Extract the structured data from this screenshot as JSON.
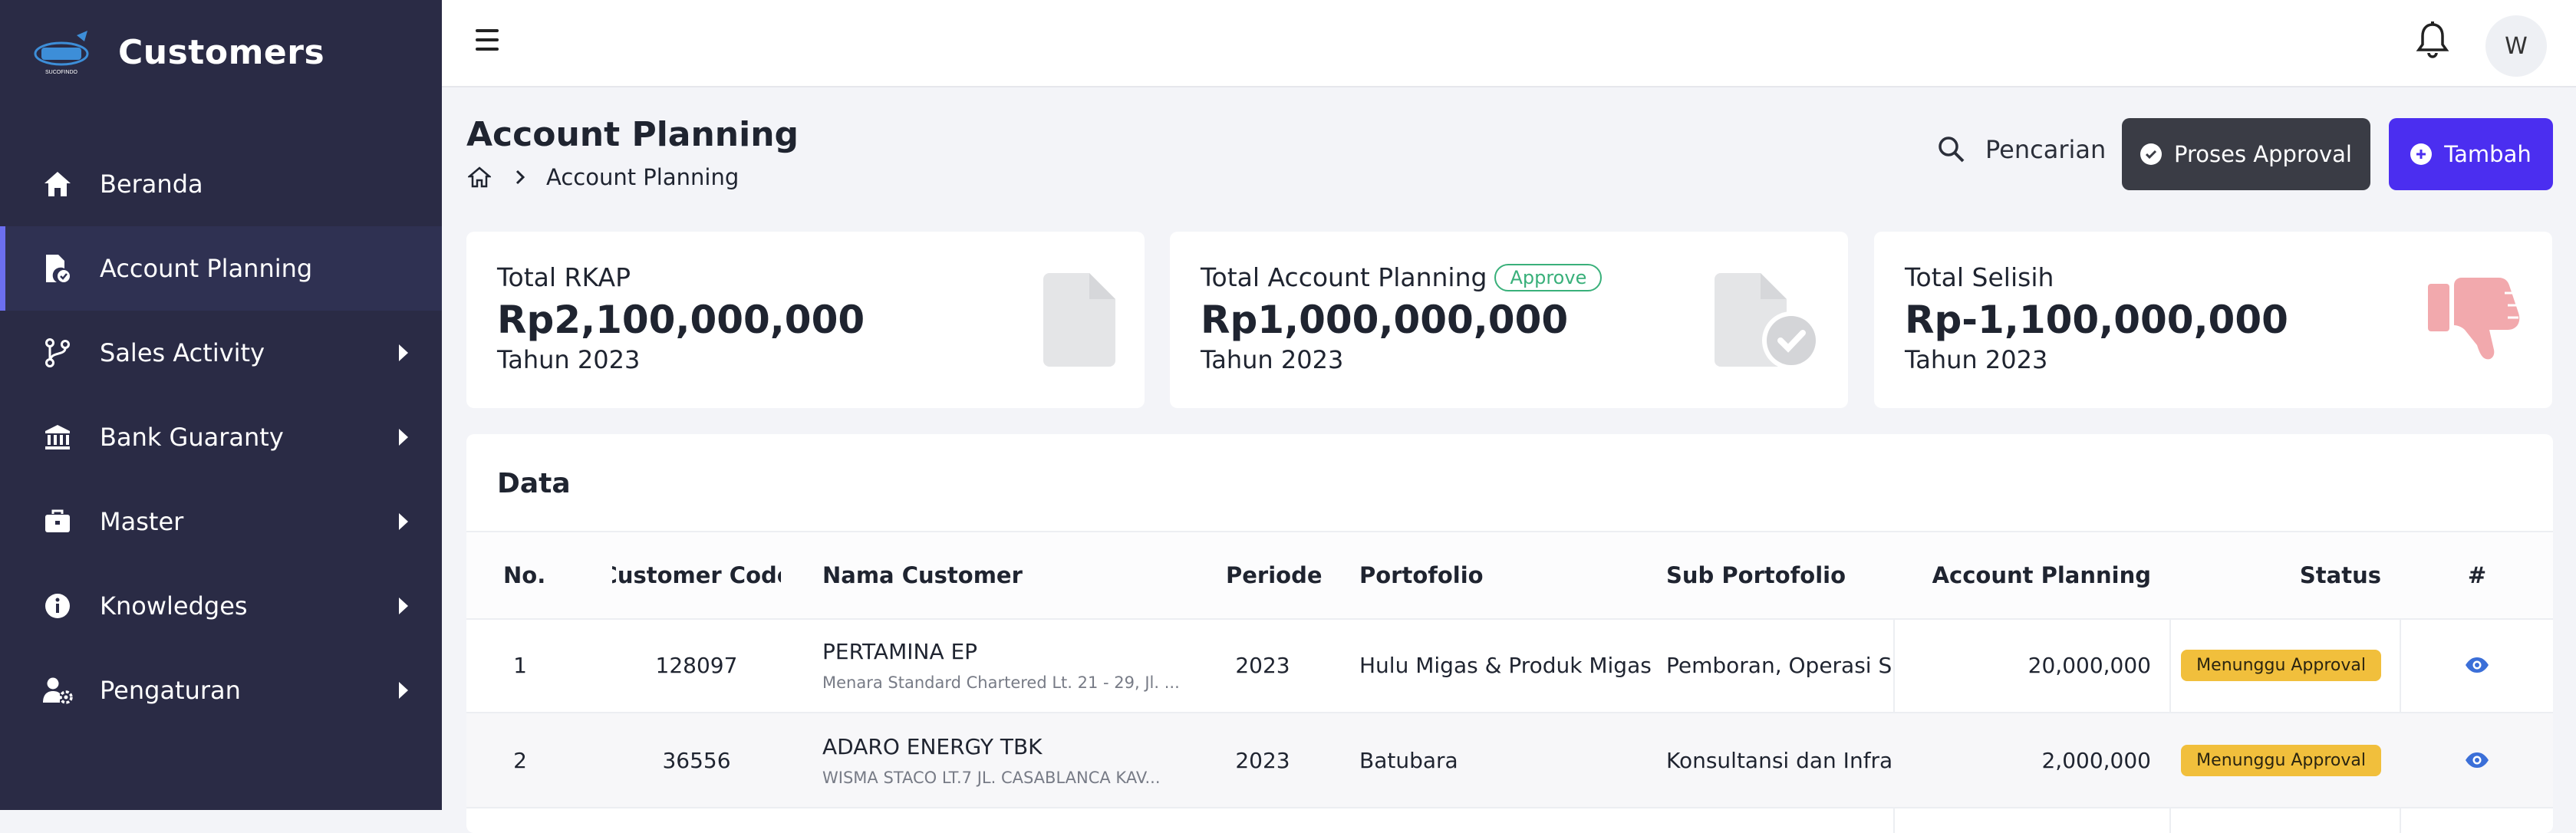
{
  "app": {
    "title": "Customers",
    "logo_text": "SUCOFINDO"
  },
  "sidebar": {
    "items": [
      {
        "label": "Beranda",
        "icon": "home-icon",
        "active": false,
        "expandable": false
      },
      {
        "label": "Account Planning",
        "icon": "file-check-icon",
        "active": true,
        "expandable": false
      },
      {
        "label": "Sales Activity",
        "icon": "branch-icon",
        "active": false,
        "expandable": true
      },
      {
        "label": "Bank Guaranty",
        "icon": "bank-icon",
        "active": false,
        "expandable": true
      },
      {
        "label": "Master",
        "icon": "briefcase-icon",
        "active": false,
        "expandable": true
      },
      {
        "label": "Knowledges",
        "icon": "info-icon",
        "active": false,
        "expandable": true
      },
      {
        "label": "Pengaturan",
        "icon": "user-gear-icon",
        "active": false,
        "expandable": true
      }
    ]
  },
  "topbar": {
    "avatar_initial": "W",
    "bell_icon": "bell-icon",
    "menu_icon": "hamburger-icon"
  },
  "header": {
    "title": "Account Planning",
    "breadcrumb": [
      "Account Planning"
    ],
    "search_label": "Pencarian",
    "approval_label": "Proses Approval",
    "add_label": "Tambah"
  },
  "summary": [
    {
      "title": "Total RKAP",
      "value": "Rp2,100,000,000",
      "sub": "Tahun 2023",
      "icon": "document-icon"
    },
    {
      "title": "Total Account Planning",
      "badge": "Approve",
      "value": "Rp1,000,000,000",
      "sub": "Tahun 2023",
      "icon": "document-check-icon"
    },
    {
      "title": "Total Selisih",
      "value": "Rp-1,100,000,000",
      "sub": "Tahun 2023",
      "icon": "thumbs-down-icon"
    }
  ],
  "table": {
    "title": "Data",
    "columns": [
      "No.",
      "Customer Code",
      "Nama Customer",
      "Periode",
      "Portofolio",
      "Sub Portofolio",
      "Account Planning",
      "Status",
      "#"
    ],
    "rows": [
      {
        "no": "1",
        "code": "128097",
        "name": "PERTAMINA EP",
        "address": "Menara Standard Chartered Lt. 21 - 29, Jl. ...",
        "periode": "2023",
        "portofolio": "Hulu Migas & Produk Migas",
        "sub_portofolio": "Pemboran, Operasi Sumb",
        "account_planning": "20,000,000",
        "status": "Menunggu Approval"
      },
      {
        "no": "2",
        "code": "36556",
        "name": "ADARO ENERGY TBK",
        "address": "WISMA STACO LT.7 JL. CASABLANCA KAV...",
        "periode": "2023",
        "portofolio": "Batubara",
        "sub_portofolio": "Konsultansi dan Infrastrul",
        "account_planning": "2,000,000",
        "status": "Menunggu Approval"
      }
    ]
  },
  "colors": {
    "sidebar_bg": "#2a2b45",
    "active_indicator": "#6c6ff0",
    "primary": "#4b2ef0",
    "dark_button": "#3a3c45",
    "approve_badge": "#39b07a",
    "status_badge": "#f1bf3c",
    "eye_icon": "#3b6fd8"
  }
}
